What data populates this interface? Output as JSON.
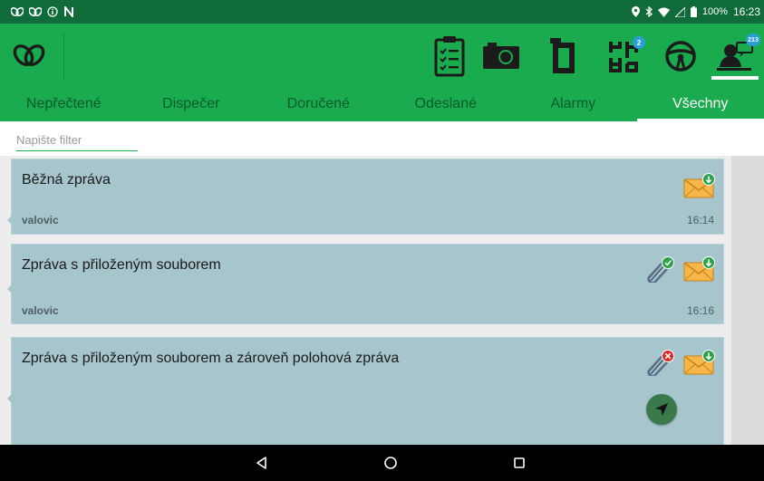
{
  "status_bar": {
    "left_icons": [
      "app-logo-icon",
      "app-logo-icon",
      "info-icon",
      "n-icon"
    ],
    "right_icons": [
      "location-icon",
      "bluetooth-icon",
      "wifi-icon",
      "signal-icon",
      "battery-icon"
    ],
    "battery": "100%",
    "time": "16:23"
  },
  "toolbar": {
    "actions": [
      {
        "name": "checklist-icon"
      },
      {
        "name": "camera-icon"
      },
      {
        "name": "route-icon"
      },
      {
        "name": "tasks-icon",
        "badge": "2"
      },
      {
        "name": "steering-wheel-icon"
      },
      {
        "name": "messages-icon",
        "badge": "213"
      }
    ]
  },
  "tabs": [
    {
      "label": "Nepřečtené",
      "active": false
    },
    {
      "label": "Dispečer",
      "active": false
    },
    {
      "label": "Doručené",
      "active": false
    },
    {
      "label": "Odeslané",
      "active": false
    },
    {
      "label": "Alarmy",
      "active": false
    },
    {
      "label": "Všechny",
      "active": true
    }
  ],
  "filter": {
    "placeholder": "Napište filter",
    "value": ""
  },
  "messages": [
    {
      "title": "Běžná zpráva",
      "sender": "valovic",
      "time": "16:14",
      "attachment": "none"
    },
    {
      "title": "Zpráva s přiloženým souborem",
      "sender": "valovic",
      "time": "16:16",
      "attachment": "ok"
    },
    {
      "title": "Zpráva s přiloženým souborem a zároveň polohová zpráva",
      "sender": "",
      "time": "",
      "attachment": "error",
      "location": true
    }
  ],
  "colors": {
    "status_bar": "#0f6b3a",
    "primary": "#1aab4e",
    "card": "#a6c5cc",
    "accent_green": "#3a7a4a"
  }
}
